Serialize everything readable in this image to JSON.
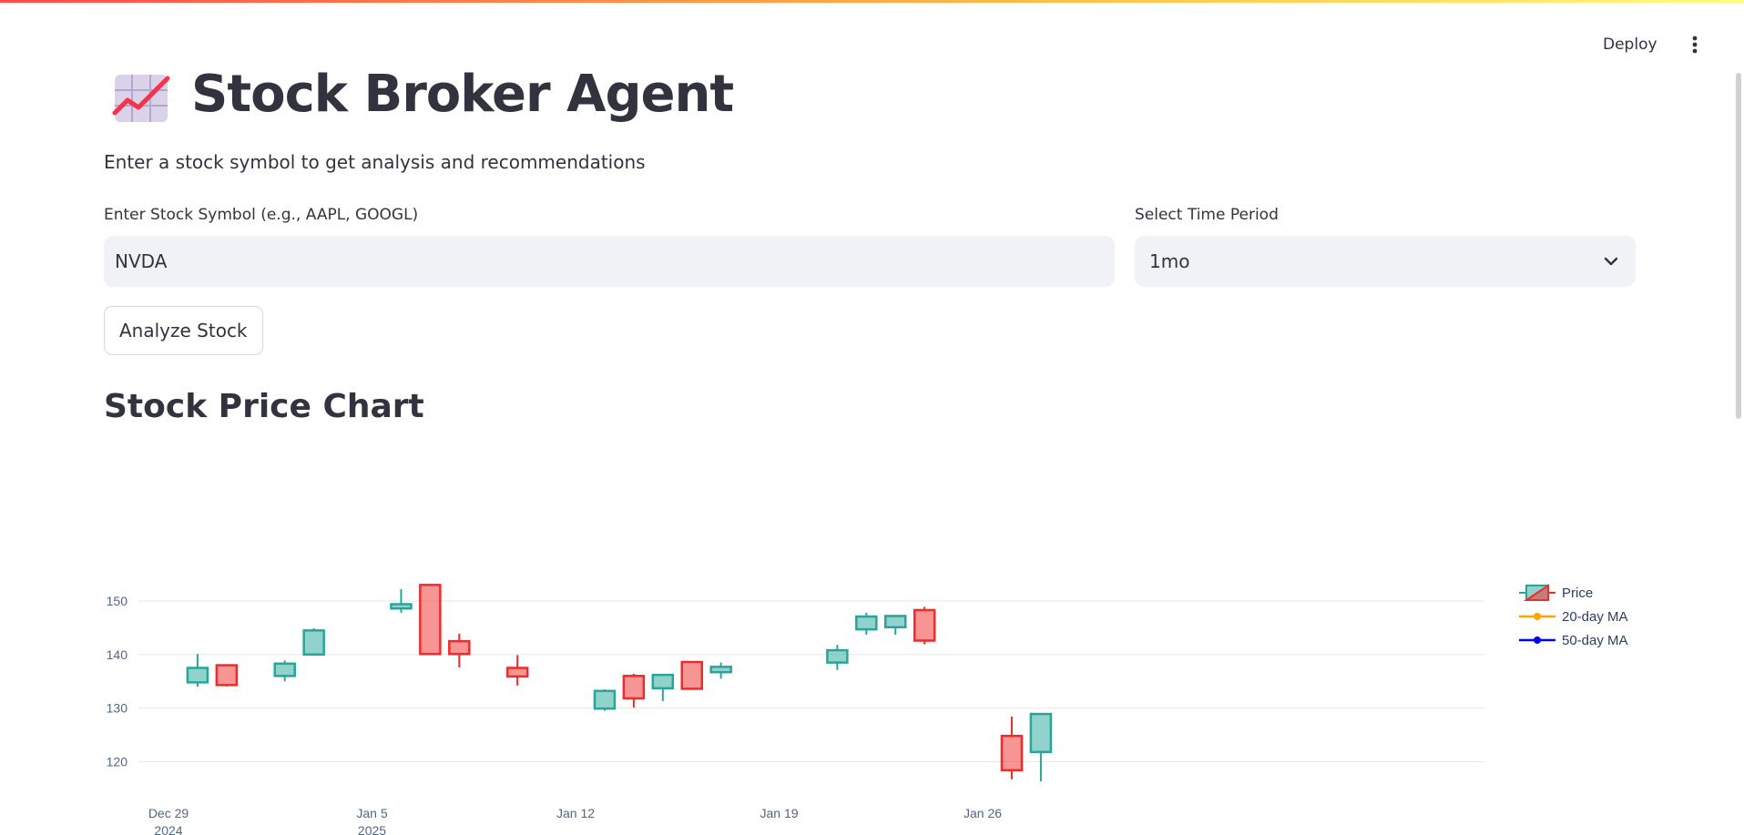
{
  "header": {
    "deploy_label": "Deploy"
  },
  "page": {
    "title": "Stock Broker Agent",
    "subtitle": "Enter a stock symbol to get analysis and recommendations"
  },
  "form": {
    "symbol_label": "Enter Stock Symbol (e.g., AAPL, GOOGL)",
    "symbol_value": "NVDA",
    "period_label": "Select Time Period",
    "period_value": "1mo",
    "analyze_label": "Analyze Stock"
  },
  "section": {
    "chart_title": "Stock Price Chart"
  },
  "colors": {
    "increasing": "#26a69a",
    "decreasing": "#ef2b2b",
    "ma20": "#ffa500",
    "ma50": "#0000ff"
  },
  "chart_data": {
    "type": "candlestick",
    "y_ticks": [
      150,
      140,
      130,
      120
    ],
    "x_ticks": [
      {
        "date": "2024-12-29",
        "label": "Dec 29",
        "sub": "2024"
      },
      {
        "date": "2025-01-05",
        "label": "Jan 5",
        "sub": "2025"
      },
      {
        "date": "2025-01-12",
        "label": "Jan 12",
        "sub": ""
      },
      {
        "date": "2025-01-19",
        "label": "Jan 19",
        "sub": ""
      },
      {
        "date": "2025-01-26",
        "label": "Jan 26",
        "sub": ""
      }
    ],
    "legend": [
      "Price",
      "20-day MA",
      "50-day MA"
    ],
    "candles": [
      {
        "date": "2024-12-30",
        "open": 134.8,
        "high": 140.1,
        "low": 134.0,
        "close": 137.5
      },
      {
        "date": "2024-12-31",
        "open": 138.0,
        "high": 138.1,
        "low": 134.0,
        "close": 134.3
      },
      {
        "date": "2025-01-02",
        "open": 136.0,
        "high": 138.9,
        "low": 135.0,
        "close": 138.3
      },
      {
        "date": "2025-01-03",
        "open": 140.0,
        "high": 144.9,
        "low": 140.0,
        "close": 144.5
      },
      {
        "date": "2025-01-06",
        "open": 148.6,
        "high": 152.2,
        "low": 147.8,
        "close": 149.4
      },
      {
        "date": "2025-01-07",
        "open": 153.0,
        "high": 153.1,
        "low": 140.1,
        "close": 140.1
      },
      {
        "date": "2025-01-08",
        "open": 142.5,
        "high": 143.9,
        "low": 137.6,
        "close": 140.1
      },
      {
        "date": "2025-01-10",
        "open": 137.5,
        "high": 139.9,
        "low": 134.2,
        "close": 135.9
      },
      {
        "date": "2025-01-13",
        "open": 129.9,
        "high": 133.5,
        "low": 129.5,
        "close": 133.2
      },
      {
        "date": "2025-01-14",
        "open": 136.0,
        "high": 136.4,
        "low": 130.1,
        "close": 131.8
      },
      {
        "date": "2025-01-15",
        "open": 133.7,
        "high": 136.4,
        "low": 131.3,
        "close": 136.2
      },
      {
        "date": "2025-01-16",
        "open": 138.6,
        "high": 138.7,
        "low": 133.5,
        "close": 133.6
      },
      {
        "date": "2025-01-17",
        "open": 136.7,
        "high": 138.5,
        "low": 135.5,
        "close": 137.7
      },
      {
        "date": "2025-01-21",
        "open": 138.5,
        "high": 141.8,
        "low": 137.1,
        "close": 140.8
      },
      {
        "date": "2025-01-22",
        "open": 144.7,
        "high": 147.8,
        "low": 143.7,
        "close": 147.1
      },
      {
        "date": "2025-01-23",
        "open": 145.1,
        "high": 147.2,
        "low": 143.7,
        "close": 147.2
      },
      {
        "date": "2025-01-24",
        "open": 148.3,
        "high": 148.9,
        "low": 141.9,
        "close": 142.6
      },
      {
        "date": "2025-01-27",
        "open": 124.8,
        "high": 128.4,
        "low": 116.7,
        "close": 118.4
      },
      {
        "date": "2025-01-28",
        "open": 121.8,
        "high": 129.0,
        "low": 116.3,
        "close": 128.9
      }
    ]
  }
}
